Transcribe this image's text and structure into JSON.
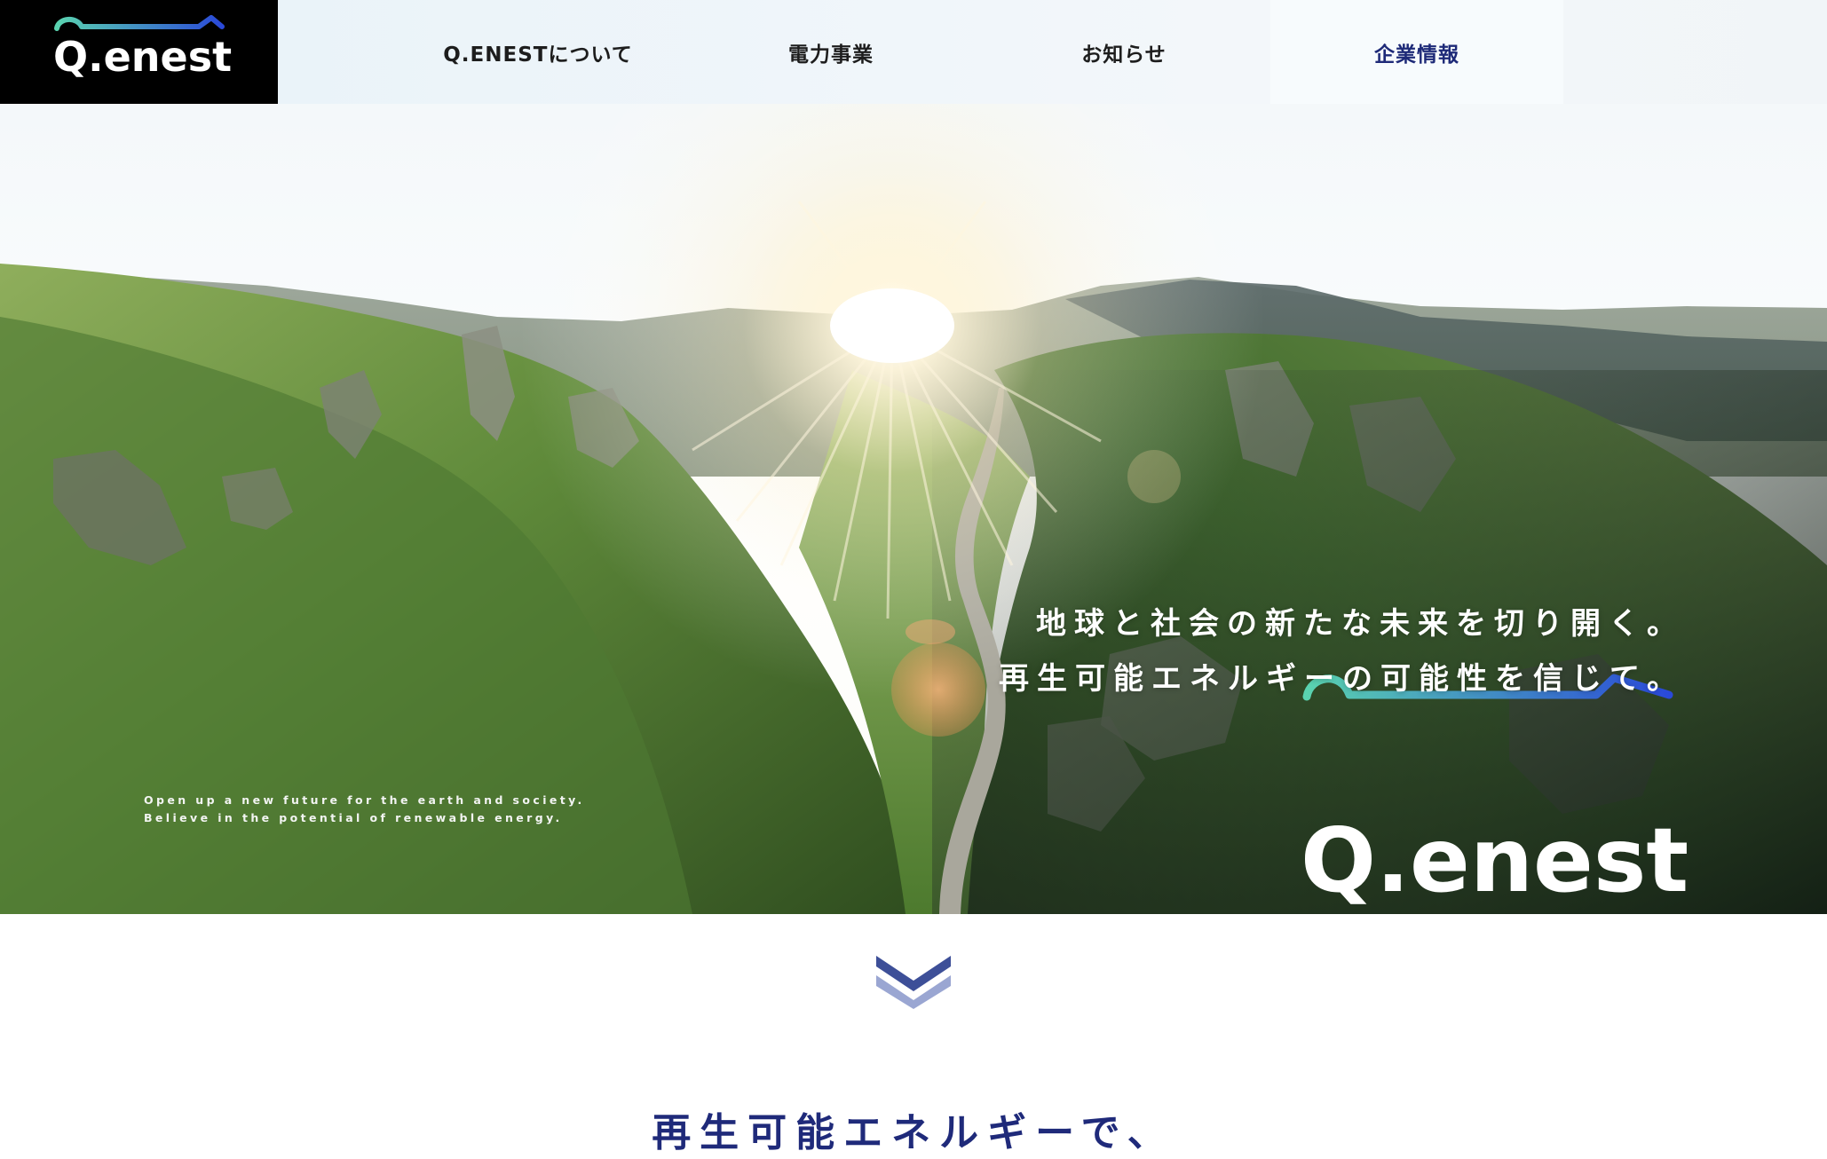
{
  "header": {
    "logo_text": "Q.enest",
    "nav": [
      {
        "label": "Q.ENESTについて"
      },
      {
        "label": "電力事業"
      },
      {
        "label": "お知らせ"
      },
      {
        "label": "企業情報"
      }
    ]
  },
  "hero": {
    "tagline_jp_line1": "地球と社会の新たな未来を切り開く。",
    "tagline_jp_line2": "再生可能エネルギーの可能性を信じて。",
    "tagline_en_line1": "Open up a new future for the earth and society.",
    "tagline_en_line2": "Believe in the potential of renewable energy.",
    "logo_text": "Q.enest"
  },
  "section": {
    "heading": "再生可能エネルギーで、"
  },
  "colors": {
    "brand_navy": "#1f2a7a",
    "logo_gradient_start": "#5ad3b0",
    "logo_gradient_end": "#1f3fbf",
    "header_bg": "#000000"
  }
}
